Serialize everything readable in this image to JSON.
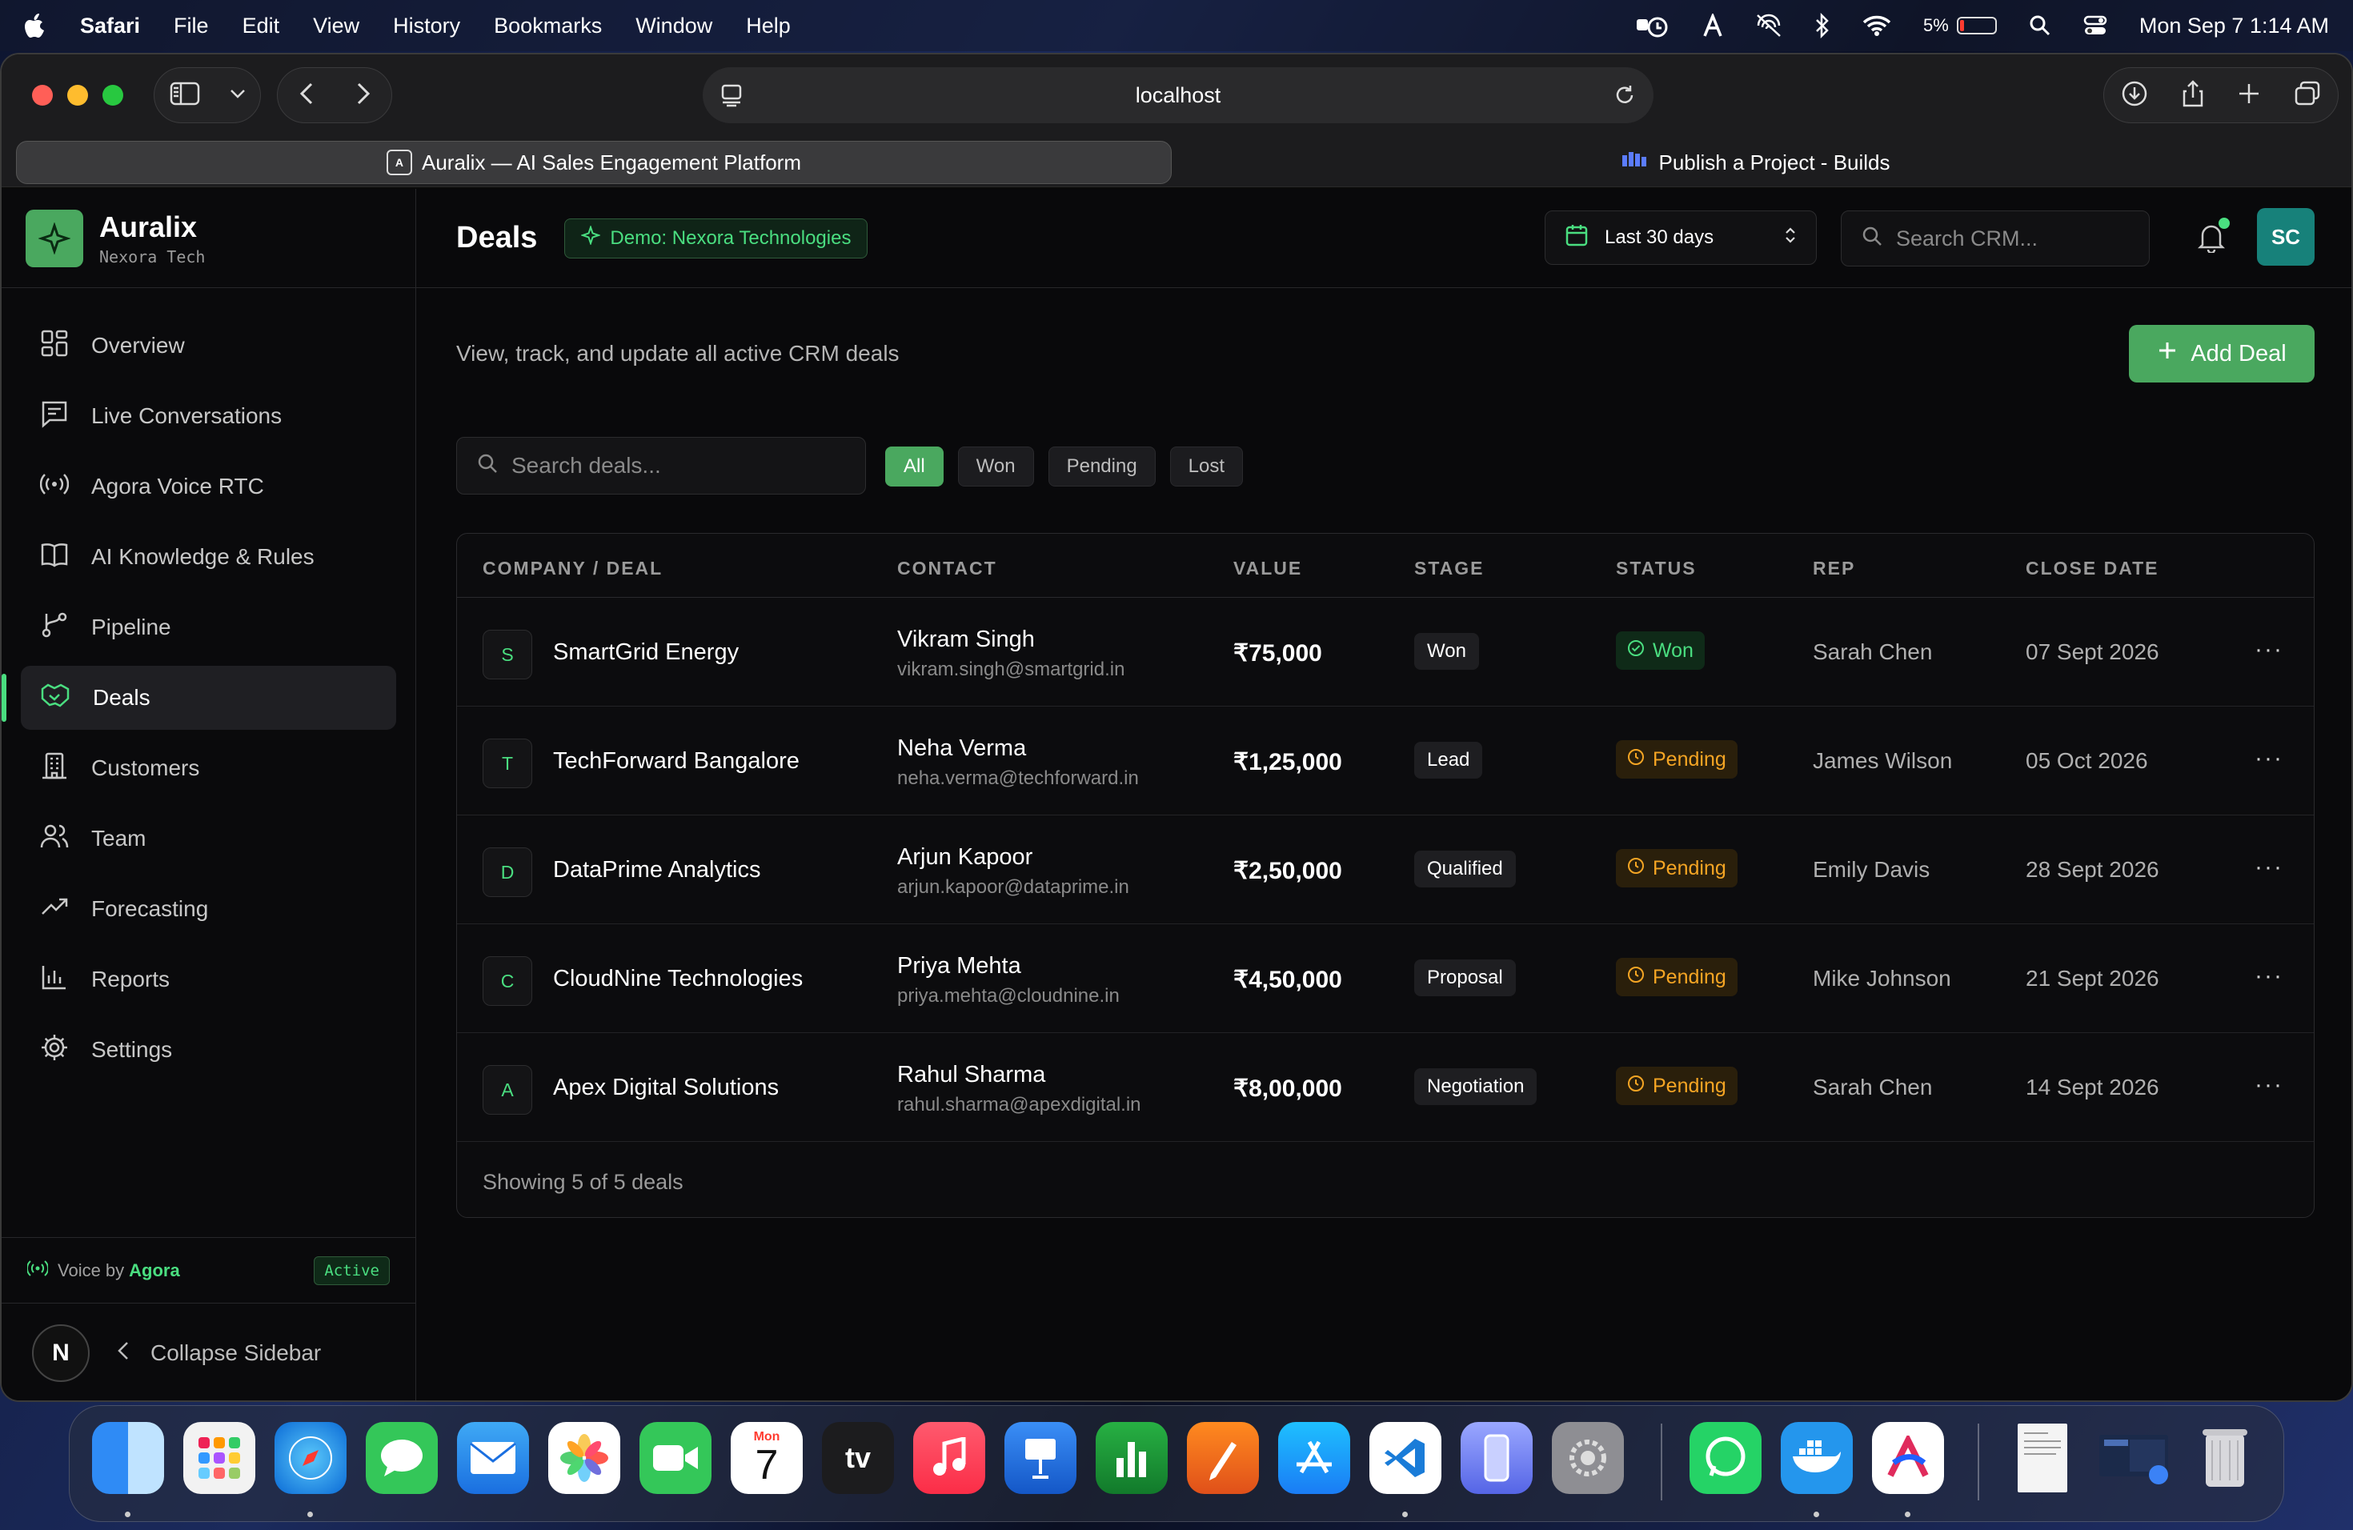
{
  "menubar": {
    "app": "Safari",
    "items": [
      "File",
      "Edit",
      "View",
      "History",
      "Bookmarks",
      "Window",
      "Help"
    ],
    "battery": "5%",
    "clock": "Mon Sep 7  1:14 AM"
  },
  "browser": {
    "url": "localhost",
    "tabs": [
      {
        "label": "Auralix — AI Sales Engagement Platform",
        "active": true
      },
      {
        "label": "Publish a Project - Builds",
        "active": false
      }
    ]
  },
  "sidebar": {
    "brand": "Auralix",
    "brand_sub": "Nexora Tech",
    "items": [
      {
        "label": "Overview",
        "icon": "grid-icon"
      },
      {
        "label": "Live Conversations",
        "icon": "message-icon"
      },
      {
        "label": "Agora Voice RTC",
        "icon": "broadcast-icon"
      },
      {
        "label": "AI Knowledge & Rules",
        "icon": "book-icon"
      },
      {
        "label": "Pipeline",
        "icon": "pipeline-icon"
      },
      {
        "label": "Deals",
        "icon": "handshake-icon",
        "active": true
      },
      {
        "label": "Customers",
        "icon": "building-icon"
      },
      {
        "label": "Team",
        "icon": "users-icon"
      },
      {
        "label": "Forecasting",
        "icon": "trend-icon"
      },
      {
        "label": "Reports",
        "icon": "bar-chart-icon"
      },
      {
        "label": "Settings",
        "icon": "gear-icon"
      }
    ],
    "voice_prefix": "Voice by",
    "voice_brand": "Agora",
    "voice_status": "Active",
    "collapse_label": "Collapse Sidebar",
    "n_badge": "N"
  },
  "header": {
    "title": "Deals",
    "demo_badge": "Demo: Nexora Technologies",
    "date_range": "Last 30 days",
    "search_placeholder": "Search CRM...",
    "avatar": "SC"
  },
  "main": {
    "subtitle": "View, track, and update all active CRM deals",
    "add_button": "Add Deal",
    "search_placeholder": "Search deals...",
    "filters": [
      "All",
      "Won",
      "Pending",
      "Lost"
    ],
    "active_filter": "All",
    "columns": [
      "COMPANY / DEAL",
      "CONTACT",
      "VALUE",
      "STAGE",
      "STATUS",
      "REP",
      "CLOSE DATE"
    ],
    "rows": [
      {
        "initial": "S",
        "company": "SmartGrid Energy",
        "contact": "Vikram Singh",
        "email": "vikram.singh@smartgrid.in",
        "value": "₹75,000",
        "stage": "Won",
        "status": "Won",
        "rep": "Sarah Chen",
        "close_date": "07 Sept 2026"
      },
      {
        "initial": "T",
        "company": "TechForward Bangalore",
        "contact": "Neha Verma",
        "email": "neha.verma@techforward.in",
        "value": "₹1,25,000",
        "stage": "Lead",
        "status": "Pending",
        "rep": "James Wilson",
        "close_date": "05 Oct 2026"
      },
      {
        "initial": "D",
        "company": "DataPrime Analytics",
        "contact": "Arjun Kapoor",
        "email": "arjun.kapoor@dataprime.in",
        "value": "₹2,50,000",
        "stage": "Qualified",
        "status": "Pending",
        "rep": "Emily Davis",
        "close_date": "28 Sept 2026"
      },
      {
        "initial": "C",
        "company": "CloudNine Technologies",
        "contact": "Priya Mehta",
        "email": "priya.mehta@cloudnine.in",
        "value": "₹4,50,000",
        "stage": "Proposal",
        "status": "Pending",
        "rep": "Mike Johnson",
        "close_date": "21 Sept 2026"
      },
      {
        "initial": "A",
        "company": "Apex Digital Solutions",
        "contact": "Rahul Sharma",
        "email": "rahul.sharma@apexdigital.in",
        "value": "₹8,00,000",
        "stage": "Negotiation",
        "status": "Pending",
        "rep": "Sarah Chen",
        "close_date": "14 Sept 2026"
      }
    ],
    "footer": "Showing 5 of 5 deals",
    "more_label": "···"
  },
  "dock": {
    "calendar_month": "Mon",
    "calendar_day": "7",
    "tv_label": "tv"
  },
  "colors": {
    "accent": "#4aa85f",
    "accent_text": "#4ade80",
    "pending": "#f5a524",
    "avatar": "#17817a"
  }
}
